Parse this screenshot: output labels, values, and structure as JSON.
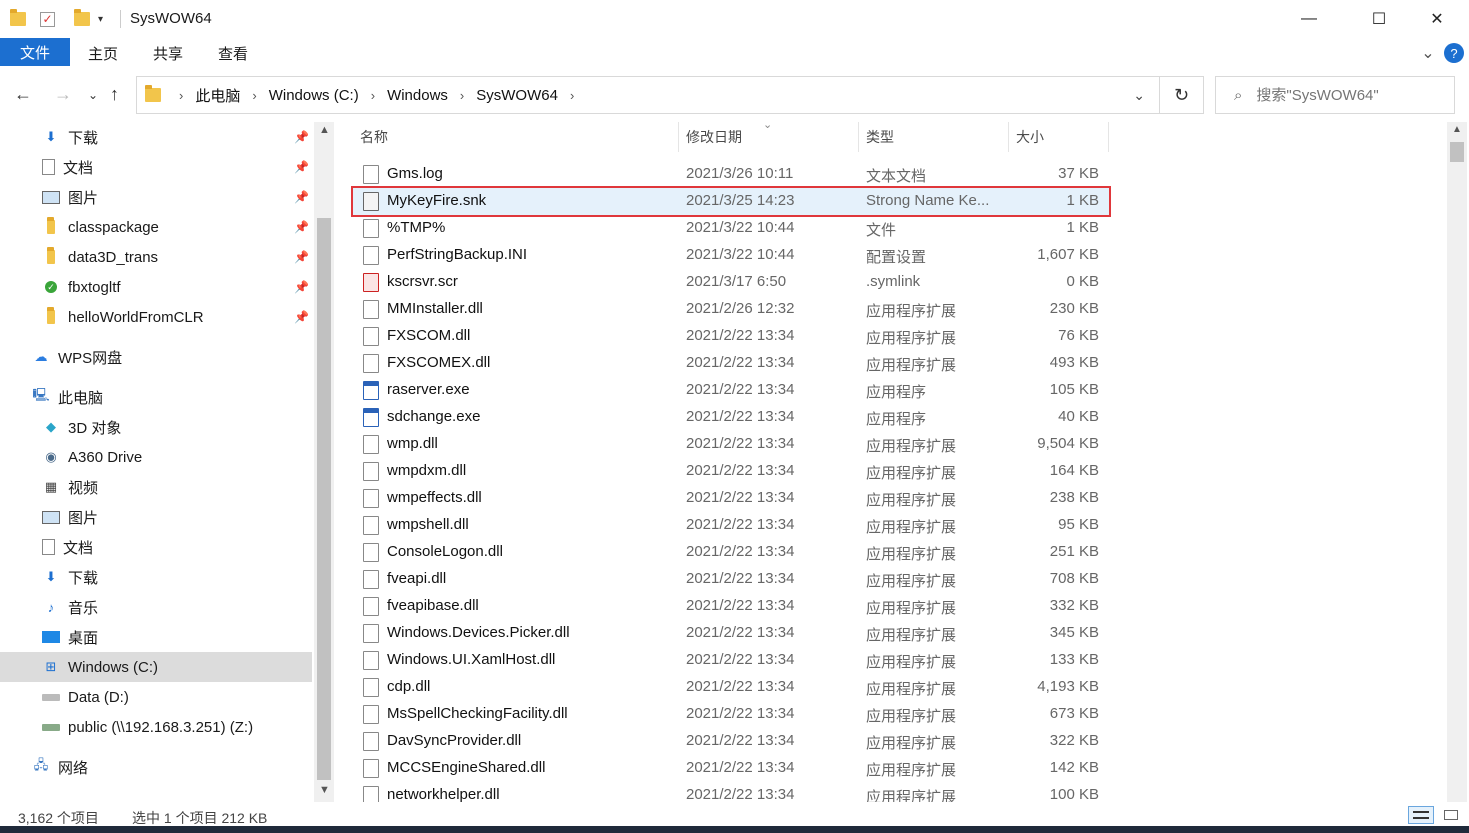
{
  "window": {
    "title": "SysWOW64",
    "minimize": "—",
    "maximize": "☐",
    "close": "✕"
  },
  "ribbon": {
    "tabs": [
      "文件",
      "主页",
      "共享",
      "查看"
    ],
    "expand": "⌄",
    "help": "?"
  },
  "address": {
    "crumbs": [
      "此电脑",
      "Windows (C:)",
      "Windows",
      "SysWOW64"
    ],
    "search_placeholder": "搜索\"SysWOW64\""
  },
  "nav": {
    "quick_access": [
      {
        "label": "下载",
        "icon": "download-icon",
        "pinned": true
      },
      {
        "label": "文档",
        "icon": "document-icon",
        "pinned": true
      },
      {
        "label": "图片",
        "icon": "picture-icon",
        "pinned": true
      },
      {
        "label": "classpackage",
        "icon": "folder-icon",
        "pinned": true
      },
      {
        "label": "data3D_trans",
        "icon": "folder-icon",
        "pinned": true
      },
      {
        "label": "fbxtogltf",
        "icon": "check-folder-icon",
        "pinned": true
      },
      {
        "label": "helloWorldFromCLR",
        "icon": "folder-icon",
        "pinned": true
      }
    ],
    "wps": "WPS网盘",
    "this_pc": "此电脑",
    "pc_items": [
      {
        "label": "3D 对象",
        "icon": "cube-icon"
      },
      {
        "label": "A360 Drive",
        "icon": "cloud-drive-icon"
      },
      {
        "label": "视频",
        "icon": "video-icon"
      },
      {
        "label": "图片",
        "icon": "picture-icon"
      },
      {
        "label": "文档",
        "icon": "document-icon"
      },
      {
        "label": "下载",
        "icon": "download-icon"
      },
      {
        "label": "音乐",
        "icon": "music-icon"
      },
      {
        "label": "桌面",
        "icon": "desktop-icon"
      },
      {
        "label": "Windows (C:)",
        "icon": "windows-drive-icon",
        "selected": true
      },
      {
        "label": "Data (D:)",
        "icon": "drive-icon"
      },
      {
        "label": "public (\\\\192.168.3.251) (Z:)",
        "icon": "network-drive-icon"
      }
    ],
    "network": "网络"
  },
  "columns": {
    "name": "名称",
    "date": "修改日期",
    "type": "类型",
    "size": "大小"
  },
  "files": [
    {
      "name": "Gms.log",
      "date": "2021/3/26 10:11",
      "type": "文本文档",
      "size": "37 KB",
      "icon": "text-file-icon"
    },
    {
      "name": "MyKeyFire.snk",
      "date": "2021/3/25 14:23",
      "type": "Strong Name Ke...",
      "size": "1 KB",
      "icon": "snk-file-icon",
      "selected": true
    },
    {
      "name": "%TMP%",
      "date": "2021/3/22 10:44",
      "type": "文件",
      "size": "1 KB",
      "icon": "file-icon"
    },
    {
      "name": "PerfStringBackup.INI",
      "date": "2021/3/22 10:44",
      "type": "配置设置",
      "size": "1,607 KB",
      "icon": "ini-file-icon"
    },
    {
      "name": "kscrsvr.scr",
      "date": "2021/3/17 6:50",
      "type": ".symlink",
      "size": "0 KB",
      "icon": "scr-file-icon"
    },
    {
      "name": "MMInstaller.dll",
      "date": "2021/2/26 12:32",
      "type": "应用程序扩展",
      "size": "230 KB",
      "icon": "dll-file-icon"
    },
    {
      "name": "FXSCOM.dll",
      "date": "2021/2/22 13:34",
      "type": "应用程序扩展",
      "size": "76 KB",
      "icon": "dll-file-icon"
    },
    {
      "name": "FXSCOMEX.dll",
      "date": "2021/2/22 13:34",
      "type": "应用程序扩展",
      "size": "493 KB",
      "icon": "dll-file-icon"
    },
    {
      "name": "raserver.exe",
      "date": "2021/2/22 13:34",
      "type": "应用程序",
      "size": "105 KB",
      "icon": "exe-file-icon"
    },
    {
      "name": "sdchange.exe",
      "date": "2021/2/22 13:34",
      "type": "应用程序",
      "size": "40 KB",
      "icon": "exe-file-icon"
    },
    {
      "name": "wmp.dll",
      "date": "2021/2/22 13:34",
      "type": "应用程序扩展",
      "size": "9,504 KB",
      "icon": "dll-file-icon"
    },
    {
      "name": "wmpdxm.dll",
      "date": "2021/2/22 13:34",
      "type": "应用程序扩展",
      "size": "164 KB",
      "icon": "dll-file-icon"
    },
    {
      "name": "wmpeffects.dll",
      "date": "2021/2/22 13:34",
      "type": "应用程序扩展",
      "size": "238 KB",
      "icon": "dll-file-icon"
    },
    {
      "name": "wmpshell.dll",
      "date": "2021/2/22 13:34",
      "type": "应用程序扩展",
      "size": "95 KB",
      "icon": "dll-file-icon"
    },
    {
      "name": "ConsoleLogon.dll",
      "date": "2021/2/22 13:34",
      "type": "应用程序扩展",
      "size": "251 KB",
      "icon": "dll-file-icon"
    },
    {
      "name": "fveapi.dll",
      "date": "2021/2/22 13:34",
      "type": "应用程序扩展",
      "size": "708 KB",
      "icon": "dll-file-icon"
    },
    {
      "name": "fveapibase.dll",
      "date": "2021/2/22 13:34",
      "type": "应用程序扩展",
      "size": "332 KB",
      "icon": "dll-file-icon"
    },
    {
      "name": "Windows.Devices.Picker.dll",
      "date": "2021/2/22 13:34",
      "type": "应用程序扩展",
      "size": "345 KB",
      "icon": "dll-file-icon"
    },
    {
      "name": "Windows.UI.XamlHost.dll",
      "date": "2021/2/22 13:34",
      "type": "应用程序扩展",
      "size": "133 KB",
      "icon": "dll-file-icon"
    },
    {
      "name": "cdp.dll",
      "date": "2021/2/22 13:34",
      "type": "应用程序扩展",
      "size": "4,193 KB",
      "icon": "dll-file-icon"
    },
    {
      "name": "MsSpellCheckingFacility.dll",
      "date": "2021/2/22 13:34",
      "type": "应用程序扩展",
      "size": "673 KB",
      "icon": "dll-file-icon"
    },
    {
      "name": "DavSyncProvider.dll",
      "date": "2021/2/22 13:34",
      "type": "应用程序扩展",
      "size": "322 KB",
      "icon": "dll-file-icon"
    },
    {
      "name": "MCCSEngineShared.dll",
      "date": "2021/2/22 13:34",
      "type": "应用程序扩展",
      "size": "142 KB",
      "icon": "dll-file-icon"
    },
    {
      "name": "networkhelper.dll",
      "date": "2021/2/22 13:34",
      "type": "应用程序扩展",
      "size": "100 KB",
      "icon": "dll-file-icon"
    }
  ],
  "status": {
    "count": "3,162 个项目",
    "selection": "选中 1 个项目  212 KB"
  },
  "colors": {
    "accent": "#1c6fd0",
    "selected_row": "#e5f1fb",
    "highlight_border": "#e0373b"
  }
}
